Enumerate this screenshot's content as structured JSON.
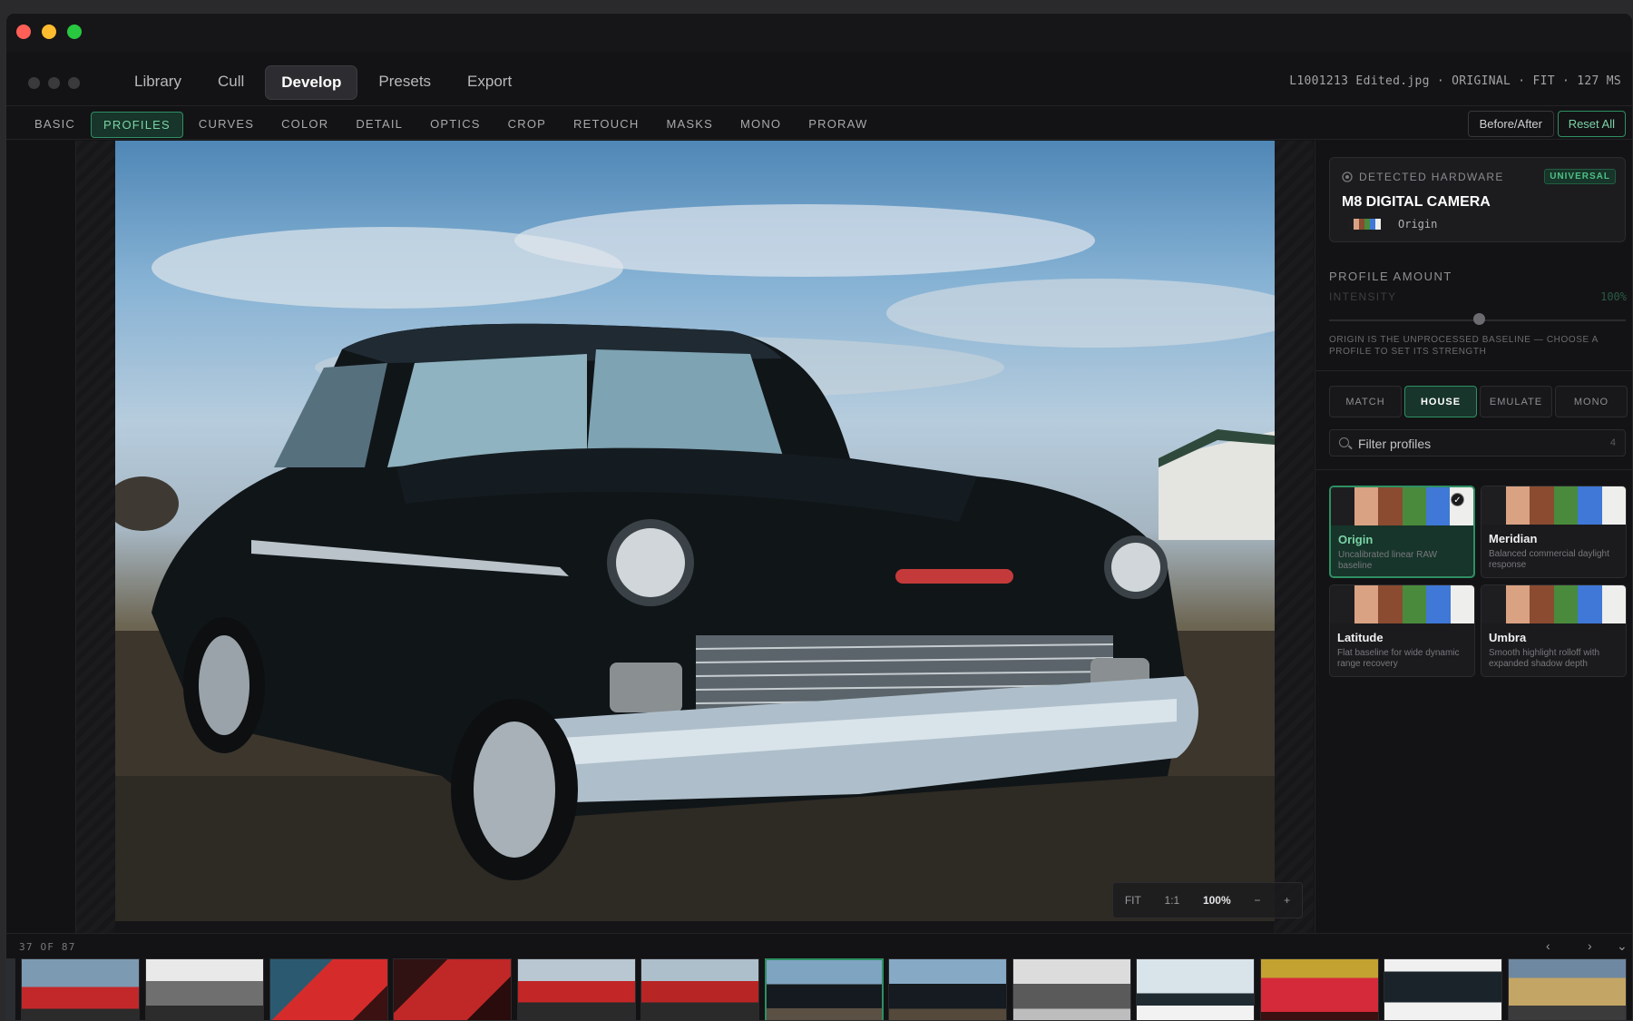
{
  "nav": {
    "tabs": [
      {
        "label": "Library"
      },
      {
        "label": "Cull"
      },
      {
        "label": "Develop"
      },
      {
        "label": "Presets"
      },
      {
        "label": "Export"
      }
    ],
    "active_tab": "Develop",
    "file_info": "L1001213 Edited.jpg · ORIGINAL · FIT · 127 MS"
  },
  "modules": {
    "tabs": [
      {
        "label": "BASIC"
      },
      {
        "label": "PROFILES"
      },
      {
        "label": "CURVES"
      },
      {
        "label": "COLOR"
      },
      {
        "label": "DETAIL"
      },
      {
        "label": "OPTICS"
      },
      {
        "label": "CROP"
      },
      {
        "label": "RETOUCH"
      },
      {
        "label": "MASKS"
      },
      {
        "label": "MONO"
      },
      {
        "label": "PRORAW"
      }
    ],
    "active": "PROFILES",
    "before_after_label": "Before/After",
    "reset_label": "Reset All"
  },
  "zoom": {
    "fit": "FIT",
    "one_to_one": "1:1",
    "level": "100%",
    "minus": "−",
    "plus": "+"
  },
  "panel": {
    "hardware": {
      "label": "DETECTED HARDWARE",
      "badge": "UNIVERSAL",
      "camera": "M8 DIGITAL CAMERA",
      "profile": "Origin"
    },
    "profile_amount": {
      "title": "PROFILE AMOUNT",
      "intensity_label": "INTENSITY",
      "intensity_value": "100%",
      "note": "ORIGIN IS THE UNPROCESSED BASELINE — CHOOSE A PROFILE TO SET ITS STRENGTH"
    },
    "categories": [
      {
        "label": "MATCH"
      },
      {
        "label": "HOUSE"
      },
      {
        "label": "EMULATE"
      },
      {
        "label": "MONO"
      }
    ],
    "active_category": "HOUSE",
    "filter": {
      "placeholder": "Filter profiles",
      "count": "4"
    },
    "profiles": [
      {
        "name": "Origin",
        "desc": "Uncalibrated linear RAW baseline",
        "selected": true
      },
      {
        "name": "Meridian",
        "desc": "Balanced commercial daylight response",
        "selected": false
      },
      {
        "name": "Latitude",
        "desc": "Flat baseline for wide dynamic range recovery",
        "selected": false
      },
      {
        "name": "Umbra",
        "desc": "Smooth highlight rolloff with expanded shadow depth",
        "selected": false
      }
    ],
    "swatch_colors": [
      "#1e1e20",
      "#d9a283",
      "#8a4b31",
      "#4a8a3c",
      "#3f78d6",
      "#eeeeec"
    ]
  },
  "filmstrip": {
    "counter": "37 OF 87",
    "prev": "‹",
    "next": "›",
    "more": "⌄",
    "selected_index": 6
  },
  "colors": {
    "accent": "#2f8f63",
    "accent_text": "#7bd3a6",
    "background": "#131315"
  }
}
